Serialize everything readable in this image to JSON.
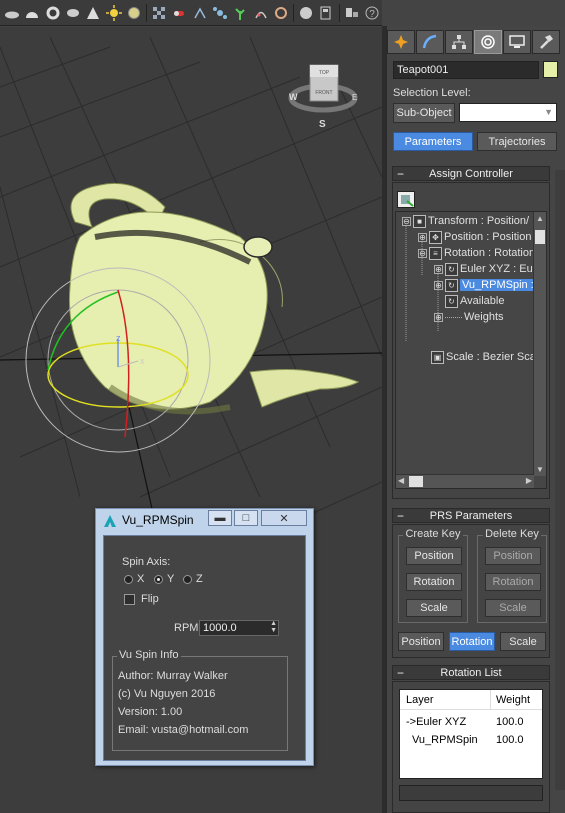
{
  "toolbar": {
    "icons": [
      "plane-icon",
      "sphere-icon",
      "torus-icon",
      "cone-icon",
      "sun-icon",
      "omni-light-icon",
      "checker-icon",
      "pill-icon",
      "bone-icon",
      "molecule-icon",
      "plant-icon",
      "fire-icon",
      "camera-reel-icon",
      "light-sphere-icon",
      "render-icon",
      "display-icon",
      "help-icon"
    ]
  },
  "viewcube": {
    "top": "TOP",
    "front": "FRONT",
    "w": "W",
    "e": "E",
    "s": "S"
  },
  "gizmo": {
    "z": "z",
    "x": "x"
  },
  "command_panel": {
    "tabs": [
      "create-tab",
      "modify-tab",
      "hierarchy-tab",
      "motion-tab",
      "display-tab",
      "utilities-tab"
    ],
    "object_name": "Teapot001",
    "selection_level_label": "Selection Level:",
    "sub_object_label": "Sub-Object",
    "sub_object_value": "",
    "parameters_label": "Parameters",
    "trajectories_label": "Trajectories",
    "assign_controller": {
      "title": "Assign Controller",
      "minus": "−",
      "tree": [
        {
          "label": "Transform : Position/",
          "expander": "⊖"
        },
        {
          "label": "Position : Position",
          "expander": "⊕"
        },
        {
          "label": "Rotation : Rotation",
          "expander": "⊖"
        },
        {
          "label": "Euler XYZ : Eu",
          "expander": "⊕"
        },
        {
          "label": "Vu_RPMSpin :",
          "expander": "⊕"
        },
        {
          "label": "Available",
          "expander": ""
        },
        {
          "label": "Weights",
          "expander": "⊕"
        },
        {
          "label": "Scale : Bezier Sca",
          "expander": ""
        }
      ]
    },
    "prs": {
      "title": "PRS Parameters",
      "create_key": "Create Key",
      "delete_key": "Delete Key",
      "position": "Position",
      "rotation": "Rotation",
      "scale": "Scale",
      "bottom": [
        "Position",
        "Rotation",
        "Scale"
      ]
    },
    "rotation_list": {
      "title": "Rotation List",
      "col_layer": "Layer",
      "col_weight": "Weight",
      "rows": [
        {
          "layer": "->Euler XYZ",
          "weight": "100.0"
        },
        {
          "layer": "Vu_RPMSpin",
          "weight": "100.0"
        }
      ]
    }
  },
  "dialog": {
    "title": "Vu_RPMSpin",
    "min": "▬",
    "max": "□",
    "close": "✕",
    "spin_axis_label": "Spin Axis:",
    "axes": [
      "X",
      "Y",
      "Z"
    ],
    "selected_axis": "Y",
    "flip_label": "Flip",
    "rpm_label": "RPM",
    "rpm_value": "1000.0",
    "info_title": "Vu Spin Info",
    "author": "Author: Murray Walker",
    "copyright": "(c) Vu Nguyen 2016",
    "version": "Version: 1.00",
    "email": "Email: vusta@hotmail.com"
  },
  "colors": {
    "teapot": "#e6eeb0",
    "selection_blue": "#4a8ae0",
    "dialog_frame": "#bfd3ea"
  }
}
